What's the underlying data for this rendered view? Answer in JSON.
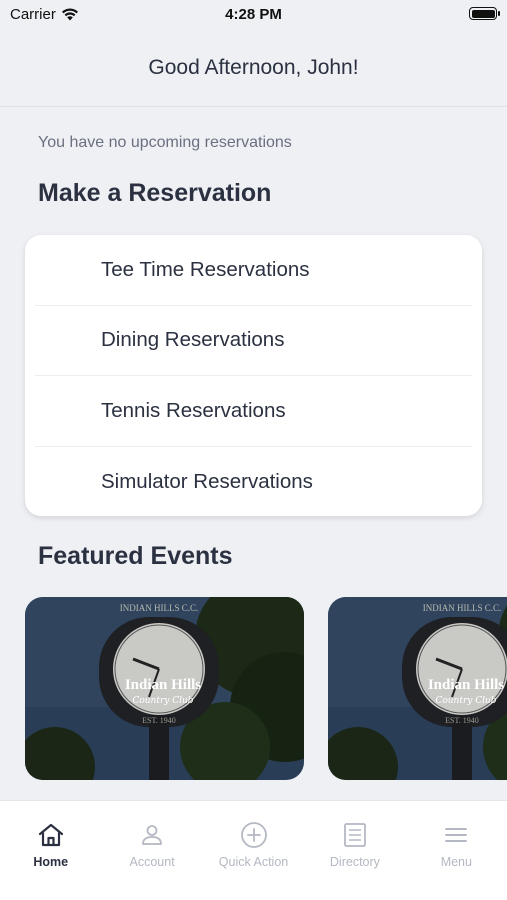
{
  "status_bar": {
    "carrier": "Carrier",
    "time": "4:28 PM"
  },
  "header": {
    "greeting": "Good Afternoon, John!"
  },
  "reservations": {
    "empty_message": "You have no upcoming reservations",
    "section_title": "Make a Reservation",
    "items": [
      {
        "label": "Tee Time Reservations"
      },
      {
        "label": "Dining Reservations"
      },
      {
        "label": "Tennis Reservations"
      },
      {
        "label": "Simulator Reservations"
      }
    ]
  },
  "events": {
    "section_title": "Featured Events",
    "cards": [
      {
        "logo_line1": "Indian Hills",
        "logo_line2": "Country Club",
        "logo_line3": "EST. 1940",
        "clock_sign": "INDIAN HILLS C.C."
      },
      {
        "logo_line1": "Indian Hills",
        "logo_line2": "Country Club",
        "logo_line3": "EST. 1940",
        "clock_sign": "INDIAN HILLS C.C."
      }
    ]
  },
  "tab_bar": {
    "tabs": [
      {
        "label": "Home",
        "icon": "home-icon",
        "active": true
      },
      {
        "label": "Account",
        "icon": "user-icon",
        "active": false
      },
      {
        "label": "Quick Action",
        "icon": "plus-circle-icon",
        "active": false
      },
      {
        "label": "Directory",
        "icon": "directory-icon",
        "active": false
      },
      {
        "label": "Menu",
        "icon": "menu-icon",
        "active": false
      }
    ]
  },
  "colors": {
    "text": "#2b3140",
    "muted": "#6b7080",
    "inactive_tab": "#b4b8c2",
    "background": "#eef0f4"
  }
}
